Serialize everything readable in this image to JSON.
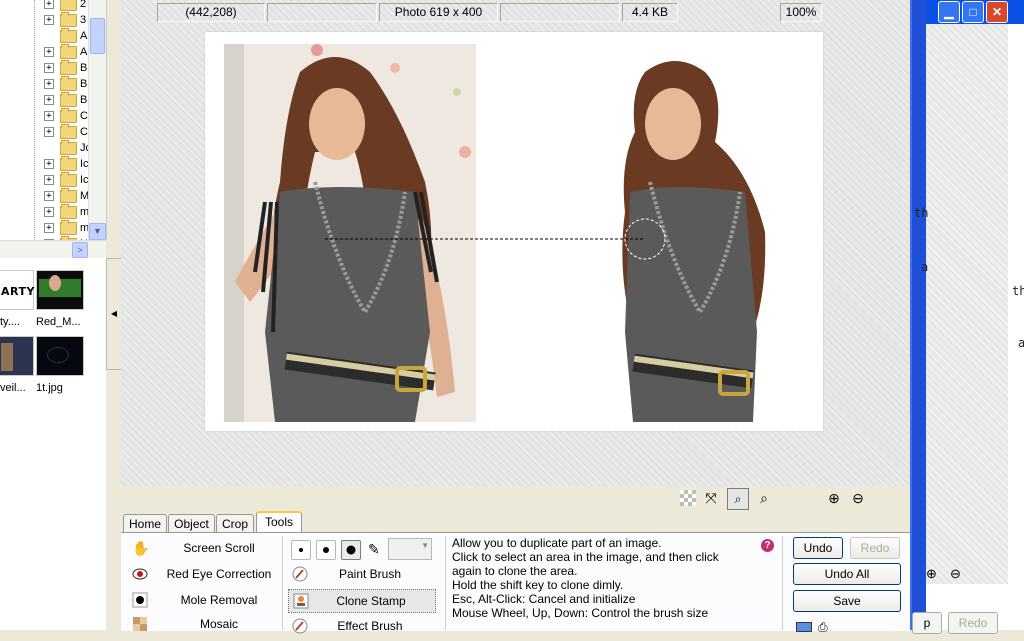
{
  "folder_tree": {
    "items": [
      {
        "label": "2"
      },
      {
        "label": "3"
      },
      {
        "label": "A"
      },
      {
        "label": "A"
      },
      {
        "label": "B"
      },
      {
        "label": "B"
      },
      {
        "label": "B"
      },
      {
        "label": "C"
      },
      {
        "label": "C"
      },
      {
        "label": "Jc"
      },
      {
        "label": "Ic"
      },
      {
        "label": "Ic"
      },
      {
        "label": "M"
      },
      {
        "label": "m"
      },
      {
        "label": "m"
      },
      {
        "label": "N"
      }
    ]
  },
  "thumbnails": [
    {
      "caption": "ty....",
      "art": "ARTY"
    },
    {
      "caption": "Red_M..."
    },
    {
      "caption": "veil..."
    },
    {
      "caption": "1t.jpg"
    }
  ],
  "status": {
    "coords": "(442,208)",
    "empty1": "",
    "photo_size": "Photo 619 x 400",
    "empty2": "",
    "file_size": "4.4 KB",
    "zoom": "100%"
  },
  "tabs": [
    {
      "label": "Home"
    },
    {
      "label": "Object"
    },
    {
      "label": "Crop"
    },
    {
      "label": "Tools",
      "active": true
    }
  ],
  "tools": [
    {
      "label": "Screen Scroll",
      "icon": "hand-icon"
    },
    {
      "label": "Red Eye Correction",
      "icon": "eye-icon"
    },
    {
      "label": "Mole Removal",
      "icon": "mole-icon"
    },
    {
      "label": "Mosaic",
      "icon": "mosaic-icon"
    }
  ],
  "brushes": [
    {
      "label": "Paint Brush",
      "icon": "paint-brush-icon"
    },
    {
      "label": "Clone Stamp",
      "icon": "clone-stamp-icon",
      "selected": true
    },
    {
      "label": "Effect Brush",
      "icon": "effect-brush-icon"
    }
  ],
  "description": {
    "lines": [
      "Allow you to duplicate part of an image.",
      "Click to select an area in the image, and then click",
      "again to clone the area.",
      "Hold the shift key to clone dimly.",
      "Esc, Alt-Click: Cancel and initialize",
      "Mouse Wheel, Up, Down: Control the brush size"
    ]
  },
  "buttons": {
    "undo": "Undo",
    "redo": "Redo",
    "undo_all": "Undo All",
    "save": "Save"
  },
  "right_window": {
    "text_fragments": [
      "th",
      "a",
      "th",
      "a"
    ],
    "button_left": "p",
    "button_redo": "Redo"
  },
  "colors": {
    "accent_tab": "#ffc83c",
    "title_blue": "#0a50e4",
    "close_red": "#d8482b"
  }
}
